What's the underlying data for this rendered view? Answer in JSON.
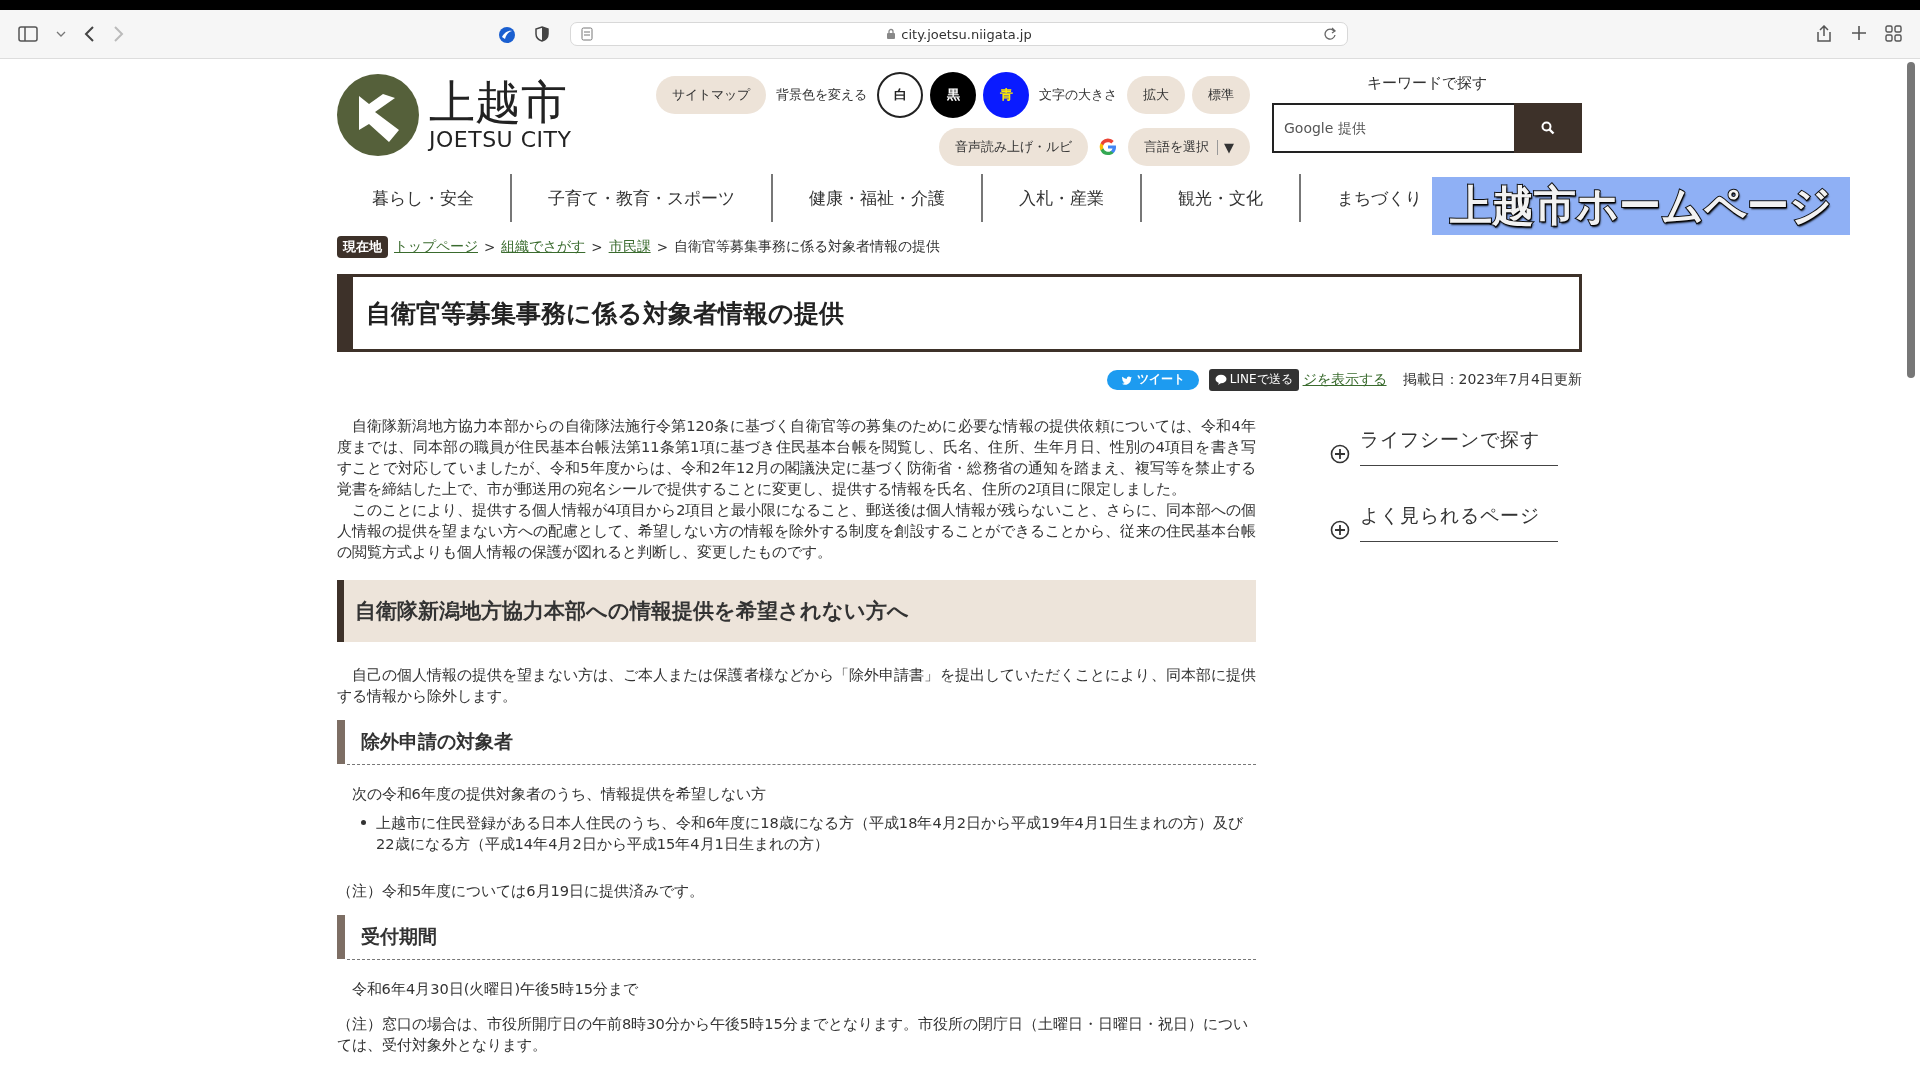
{
  "browser": {
    "url": "city.joetsu.niigata.jp"
  },
  "header": {
    "logo": {
      "name": "上越市",
      "subtitle": "JOETSU CITY"
    },
    "sitemap": "サイトマップ",
    "bg_label": "背景色を変える",
    "bg_options": [
      {
        "label": "白",
        "kind": "white"
      },
      {
        "label": "黒",
        "kind": "black"
      },
      {
        "label": "青",
        "kind": "blue"
      }
    ],
    "size_label": "文字の大きさ",
    "size_buttons": [
      "拡大",
      "標準"
    ],
    "voice": "音声読み上げ・ルビ",
    "language": "言語を選択",
    "language_caret": "▼",
    "search": {
      "label": "キーワードで探す",
      "placeholder": "Google 提供"
    }
  },
  "nav": [
    "暮らし・安全",
    "子育て・教育・スポーツ",
    "健康・福祉・介護",
    "入札・産業",
    "観光・文化",
    "まちづくり"
  ],
  "caption": "上越市ホームページ",
  "breadcrumb": {
    "label": "現在地",
    "separator": ">",
    "items": [
      {
        "text": "トップページ",
        "link": true
      },
      {
        "text": "組織でさがす",
        "link": true
      },
      {
        "text": "市民課",
        "link": true
      },
      {
        "text": "自衛官等募集事務に係る対象者情報の提供",
        "link": false
      }
    ]
  },
  "title": "自衛官等募集事務に係る対象者情報の提供",
  "share": {
    "tweet": "ツイート",
    "line": "LINEで送る",
    "link": "ジを表示する",
    "date": "掲載日：2023年7月4日更新"
  },
  "blocks": [
    {
      "kind": "p",
      "text": "自衛隊新潟地方協力本部からの自衛隊法施行令第120条に基づく自衛官等の募集のために必要な情報の提供依頼については、令和4年度までは、同本部の職員が住民基本台帳法第11条第1項に基づき住民基本台帳を閲覧し、氏名、住所、生年月日、性別の4項目を書き写すことで対応していましたが、令和5年度からは、令和2年12月の閣議決定に基づく防衛省・総務省の通知を踏まえ、複写等を禁止する覚書を締結した上で、市が郵送用の宛名シールで提供することに変更し、提供する情報を氏名、住所の2項目に限定しました。"
    },
    {
      "kind": "p",
      "text": "このことにより、提供する個人情報が4項目から2項目と最小限になること、郵送後は個人情報が残らないこと、さらに、同本部への個人情報の提供を望まない方への配慮として、希望しない方の情報を除外する制度を創設することができることから、従来の住民基本台帳の閲覧方式よりも個人情報の保護が図れると判断し、変更したものです。"
    },
    {
      "kind": "h2",
      "text": "自衛隊新潟地方協力本部への情報提供を希望されない方へ"
    },
    {
      "kind": "p",
      "text": "自己の個人情報の提供を望まない方は、ご本人または保護者様などから「除外申請書」を提出していただくことにより、同本部に提供する情報から除外します。"
    },
    {
      "kind": "h3",
      "text": "除外申請の対象者"
    },
    {
      "kind": "p",
      "text": "次の令和6年度の提供対象者のうち、情報提供を希望しない方"
    },
    {
      "kind": "bullet",
      "text": "上越市に住民登録がある日本人住民のうち、令和6年度に18歳になる方（平成18年4月2日から平成19年4月1日生まれの方）及び22歳になる方（平成14年4月2日から平成15年4月1日生まれの方）"
    },
    {
      "kind": "note",
      "text": "（注）令和5年度については6月19日に提供済みです。"
    },
    {
      "kind": "h3",
      "text": "受付期間"
    },
    {
      "kind": "p",
      "text": "令和6年4月30日(火曜日)午後5時15分まで"
    },
    {
      "kind": "note",
      "text": "（注）窓口の場合は、市役所開庁日の午前8時30分から午後5時15分までとなります。市役所の閉庁日（土曜日・日曜日・祝日）については、受付対象外となります。"
    }
  ],
  "sidebar": [
    {
      "label": "ライフシーンで探す"
    },
    {
      "label": "よく見られるページ"
    }
  ]
}
